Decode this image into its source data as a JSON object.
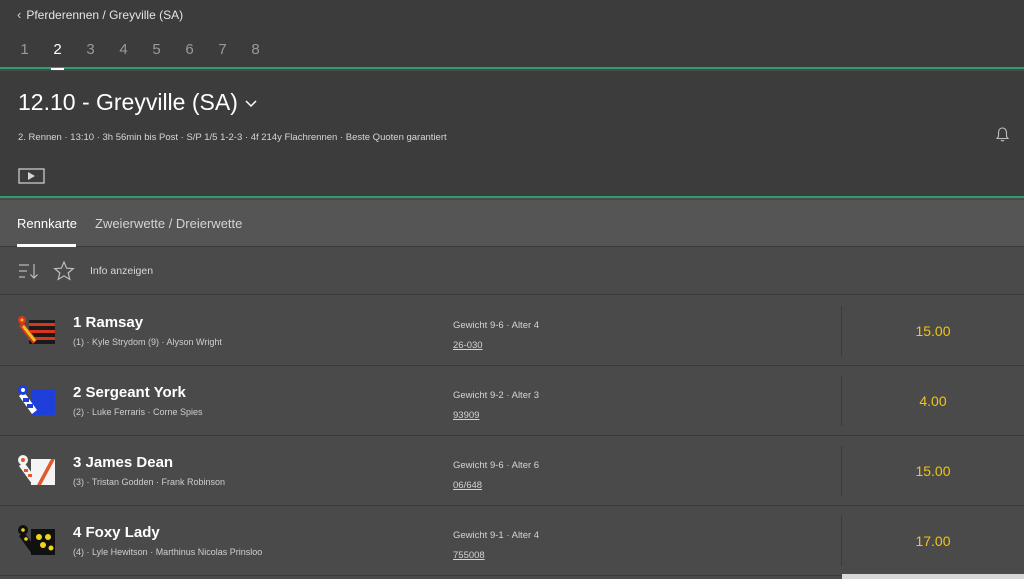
{
  "breadcrumb": {
    "label": "Pferderennen / Greyville (SA)"
  },
  "race_tabs": [
    "1",
    "2",
    "3",
    "4",
    "5",
    "6",
    "7",
    "8"
  ],
  "active_race_tab": "2",
  "header": {
    "title": "12.10 - Greyville (SA)",
    "info": "2. Rennen · 13:10 · 3h 56min bis Post · S/P 1/5 1-2-3 · 4f 214y Flachrennen · Beste Quoten garantiert"
  },
  "subtabs": {
    "racecard": "Rennkarte",
    "forecast": "Zweierwette / Dreierwette",
    "active": "Rennkarte"
  },
  "toolbar": {
    "info_label": "Info anzeigen"
  },
  "runners": [
    {
      "number": "1",
      "name": "Ramsay",
      "jockey_trainer": "(1) · Kyle Strydom (9) · Alyson Wright",
      "weight_age": "Gewicht 9-6 · Alter 4",
      "form": "26-030",
      "odds": "15.00",
      "silk": "red-black-hoops-silk"
    },
    {
      "number": "2",
      "name": "Sergeant York",
      "jockey_trainer": "(2) · Luke Ferraris · Corne Spies",
      "weight_age": "Gewicht 9-2 · Alter 3",
      "form": "93909",
      "odds": "4.00",
      "silk": "blue-white-silk"
    },
    {
      "number": "3",
      "name": "James Dean",
      "jockey_trainer": "(3) · Tristan Godden · Frank Robinson",
      "weight_age": "Gewicht 9-6 · Alter 6",
      "form": "06/648",
      "odds": "15.00",
      "silk": "white-orange-sash-silk"
    },
    {
      "number": "4",
      "name": "Foxy Lady",
      "jockey_trainer": "(4) · Lyle Hewitson · Marthinus Nicolas Prinsloo",
      "weight_age": "Gewicht 9-1 · Alter 4",
      "form": "755008",
      "odds": "17.00",
      "silk": "black-yellow-spots-silk"
    }
  ],
  "colors": {
    "accent_green": "#2f9e6e",
    "odds_yellow": "#f0c419",
    "background": "#4a4a4a",
    "header_bg": "#3c3c3c"
  }
}
